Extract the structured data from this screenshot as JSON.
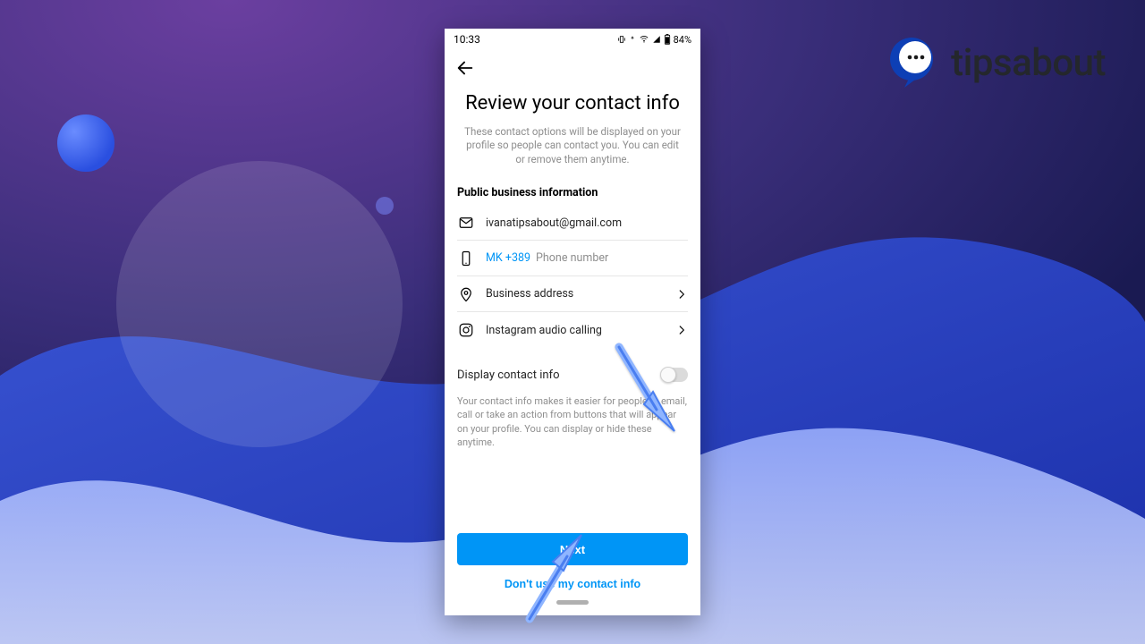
{
  "statusbar": {
    "time": "10:33",
    "battery": "84%"
  },
  "appbar": {
    "back_icon": "arrow-left"
  },
  "page": {
    "title": "Review your contact info",
    "subtitle": "These contact options will be displayed on your profile so people can contact you. You can edit or remove them anytime.",
    "section_label": "Public business information"
  },
  "rows": {
    "email": {
      "value": "ivanatipsabout@gmail.com"
    },
    "phone": {
      "prefix": "MK +389",
      "placeholder": "Phone number"
    },
    "address": {
      "label": "Business address"
    },
    "audio": {
      "label": "Instagram audio calling"
    }
  },
  "toggle": {
    "label": "Display contact info",
    "on": false
  },
  "helper": "Your contact info makes it easier for people to email, call or take an action from buttons that will appear on your profile. You can display or hide these anytime.",
  "buttons": {
    "primary": "Next",
    "secondary": "Don't use my contact info"
  },
  "brand": {
    "name": "tipsabout"
  },
  "colors": {
    "accent": "#0095f6",
    "muted": "#8e8e8e"
  }
}
